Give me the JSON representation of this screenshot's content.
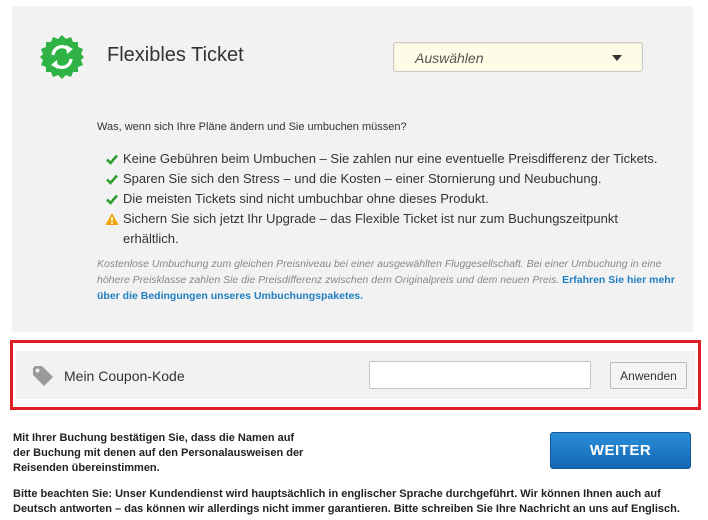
{
  "ticket": {
    "title": "Flexibles Ticket",
    "select": {
      "value": "Auswählen"
    },
    "question": "Was, wenn sich Ihre Pläne ändern und Sie umbuchen müssen?",
    "benefits": [
      {
        "icon": "check-icon",
        "text": "Keine Gebühren beim Umbuchen – Sie zahlen nur eine eventuelle Preisdifferenz der Tickets."
      },
      {
        "icon": "check-icon",
        "text": "Sparen Sie sich den Stress – und die Kosten – einer Stornierung und Neubuchung."
      },
      {
        "icon": "check-icon",
        "text": "Die meisten Tickets sind nicht umbuchbar ohne dieses Produkt."
      },
      {
        "icon": "warning-icon",
        "text": "Sichern Sie sich jetzt Ihr Upgrade – das Flexible Ticket ist nur zum Buchungszeitpunkt erhältlich."
      }
    ],
    "note": "Kostenlose Umbuchung zum gleichen Preisniveau bei einer ausgewählten Fluggesellschaft. Bei einer Umbuchung in eine höhere Preisklasse zahlen Sie die Preisdifferenz zwischen dem Originalpreis und dem neuen Preis.",
    "note_link": "Erfahren Sie hier mehr über die Bedingungen unseres Umbuchungspaketes."
  },
  "coupon": {
    "label": "Mein Coupon-Kode",
    "input_value": "",
    "apply_label": "Anwenden"
  },
  "footer": {
    "confirm": "Mit Ihrer Buchung bestätigen Sie, dass die Namen auf der Buchung mit denen auf den Personalausweisen der Reisenden übereinstimmen.",
    "next_label": "WEITER",
    "notice": "Bitte beachten Sie: Unser Kundendienst wird hauptsächlich in englischer Sprache durchgeführt. Wir können Ihnen auch auf Deutsch antworten – das können wir allerdings nicht immer garantieren. Bitte schreiben Sie Ihre Nachricht an uns auf Englisch."
  },
  "colors": {
    "badge_green": "#2fb344",
    "check_green": "#2e9e2e",
    "warning_orange": "#f0a30a",
    "highlight_red": "#e01e26",
    "link_blue": "#1f7fc0",
    "button_blue": "#1a78c8"
  }
}
